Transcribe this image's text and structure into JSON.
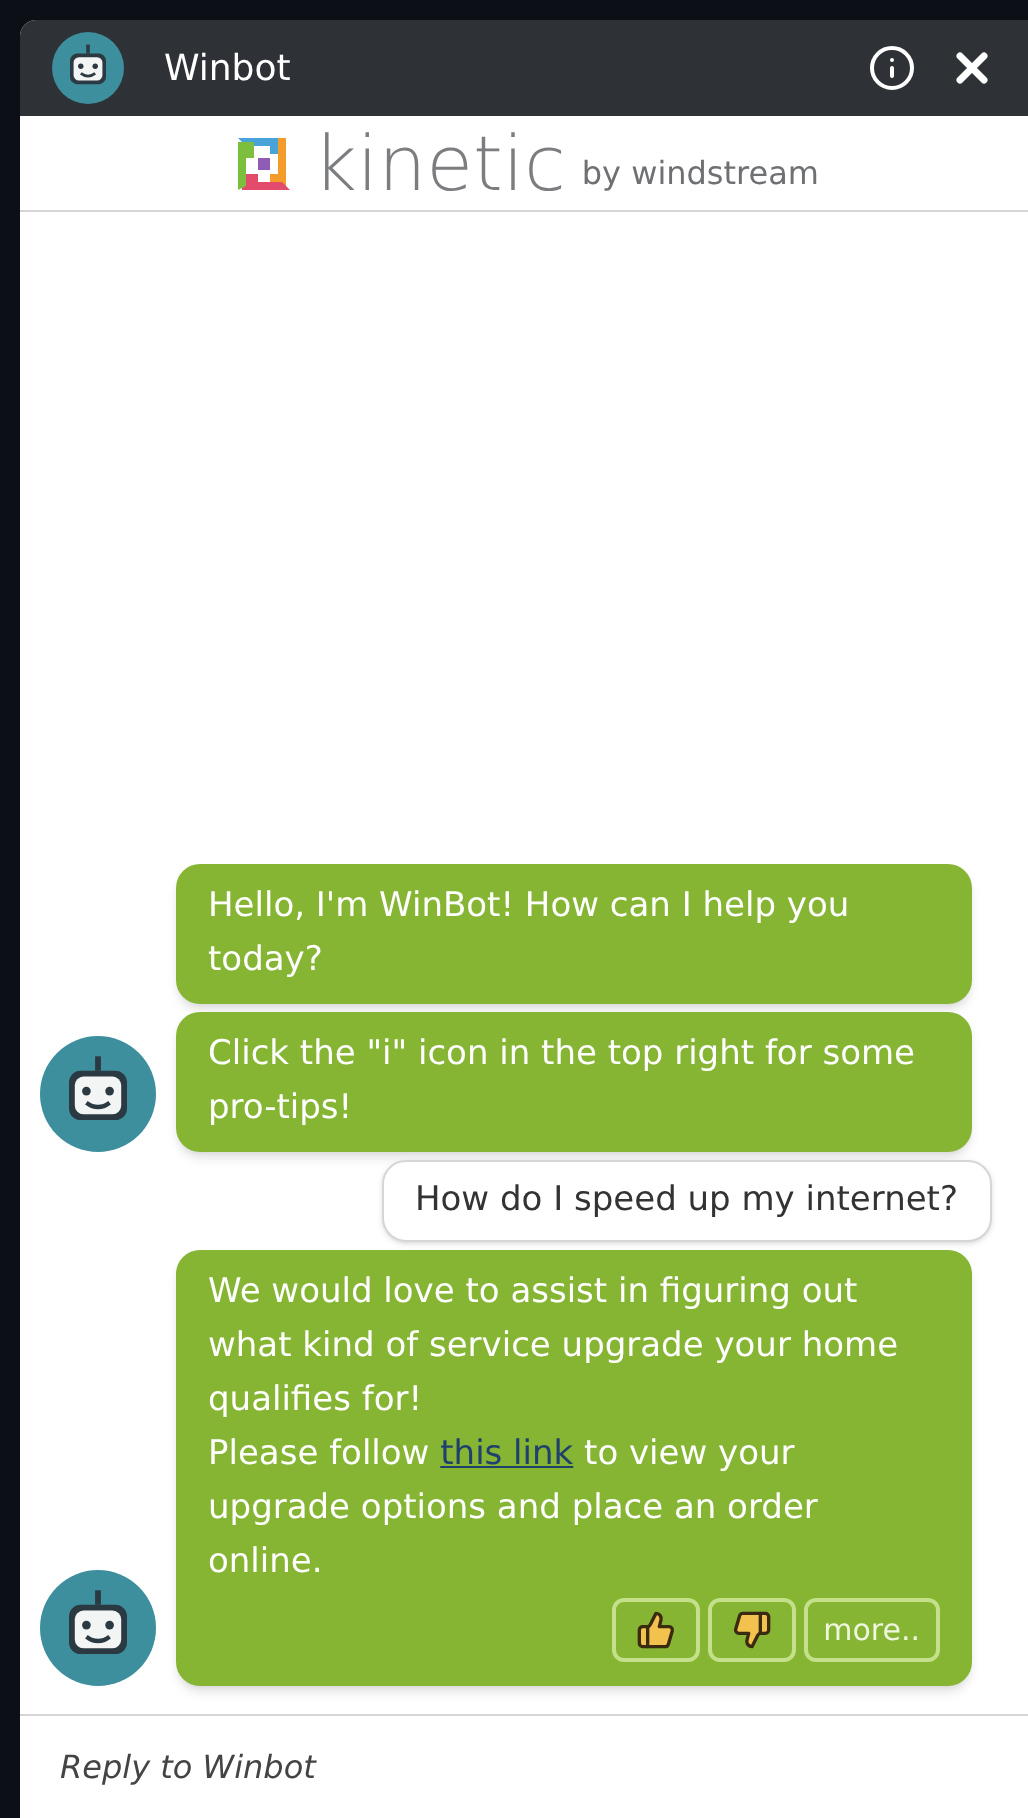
{
  "header": {
    "title": "Winbot"
  },
  "logo": {
    "wordmark": "kinetic",
    "byline": "by windstream"
  },
  "messages": [
    {
      "kind": "bot",
      "avatar": false,
      "text": "Hello, I'm WinBot! How can I help you today?"
    },
    {
      "kind": "bot",
      "avatar": true,
      "text": "Click the \"i\" icon in the top right for some pro-tips!"
    },
    {
      "kind": "user",
      "text": "How do I speed up my internet?"
    },
    {
      "kind": "bot_link",
      "avatar": true,
      "text": "We would love to assist in figuring out what kind of service upgrade your home qualifies for!",
      "before": "Please follow ",
      "link": "this link",
      "after": " to view your upgrade options and place an order online.",
      "more": "more.."
    }
  ],
  "reply": {
    "placeholder": "Reply to Winbot"
  }
}
